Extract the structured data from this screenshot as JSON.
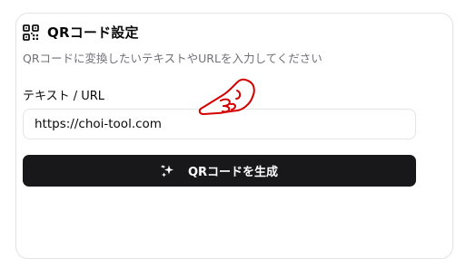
{
  "card": {
    "title": "QRコード設定",
    "description": "QRコードに変換したいテキストやURLを入力してください",
    "field_label": "テキスト / URL",
    "input_value": "https://choi-tool.com",
    "generate_label": "QRコードを生成"
  },
  "icons": {
    "title_icon": "qr-code-icon",
    "button_icon": "sparkle-icon",
    "cursor": "pointing-hand-cursor"
  },
  "colors": {
    "button_bg": "#18181b",
    "muted_text": "#71717a",
    "border": "#e4e4e7",
    "cursor_stroke": "#d40000"
  }
}
